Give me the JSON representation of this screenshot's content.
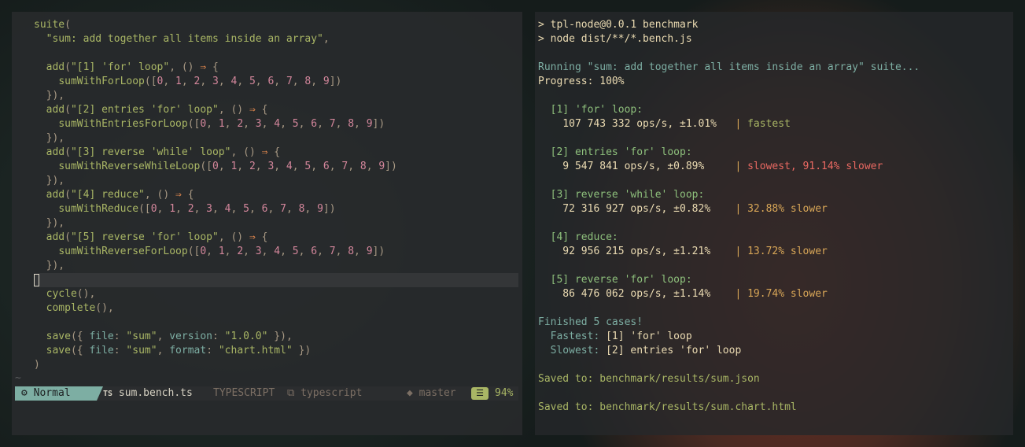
{
  "editor": {
    "lines": [
      [
        {
          "c": "fn",
          "t": "suite"
        },
        {
          "c": "punc",
          "t": "("
        }
      ],
      [
        {
          "c": "plain",
          "t": "  "
        },
        {
          "c": "str",
          "t": "\"sum: add together all items inside an array\""
        },
        {
          "c": "punc",
          "t": ","
        }
      ],
      [],
      [
        {
          "c": "plain",
          "t": "  "
        },
        {
          "c": "fn",
          "t": "add"
        },
        {
          "c": "punc",
          "t": "("
        },
        {
          "c": "str",
          "t": "\"[1] 'for' loop\""
        },
        {
          "c": "punc",
          "t": ", "
        },
        {
          "c": "punc",
          "t": "() "
        },
        {
          "c": "op",
          "t": "⇒"
        },
        {
          "c": "punc",
          "t": " {"
        }
      ],
      [
        {
          "c": "plain",
          "t": "    "
        },
        {
          "c": "fn",
          "t": "sumWithForLoop"
        },
        {
          "c": "punc",
          "t": "(["
        },
        {
          "c": "num",
          "t": "0"
        },
        {
          "c": "punc",
          "t": ", "
        },
        {
          "c": "num",
          "t": "1"
        },
        {
          "c": "punc",
          "t": ", "
        },
        {
          "c": "num",
          "t": "2"
        },
        {
          "c": "punc",
          "t": ", "
        },
        {
          "c": "num",
          "t": "3"
        },
        {
          "c": "punc",
          "t": ", "
        },
        {
          "c": "num",
          "t": "4"
        },
        {
          "c": "punc",
          "t": ", "
        },
        {
          "c": "num",
          "t": "5"
        },
        {
          "c": "punc",
          "t": ", "
        },
        {
          "c": "num",
          "t": "6"
        },
        {
          "c": "punc",
          "t": ", "
        },
        {
          "c": "num",
          "t": "7"
        },
        {
          "c": "punc",
          "t": ", "
        },
        {
          "c": "num",
          "t": "8"
        },
        {
          "c": "punc",
          "t": ", "
        },
        {
          "c": "num",
          "t": "9"
        },
        {
          "c": "punc",
          "t": "])"
        }
      ],
      [
        {
          "c": "plain",
          "t": "  "
        },
        {
          "c": "punc",
          "t": "}),"
        }
      ],
      [
        {
          "c": "plain",
          "t": "  "
        },
        {
          "c": "fn",
          "t": "add"
        },
        {
          "c": "punc",
          "t": "("
        },
        {
          "c": "str",
          "t": "\"[2] entries 'for' loop\""
        },
        {
          "c": "punc",
          "t": ", "
        },
        {
          "c": "punc",
          "t": "() "
        },
        {
          "c": "op",
          "t": "⇒"
        },
        {
          "c": "punc",
          "t": " {"
        }
      ],
      [
        {
          "c": "plain",
          "t": "    "
        },
        {
          "c": "fn",
          "t": "sumWithEntriesForLoop"
        },
        {
          "c": "punc",
          "t": "(["
        },
        {
          "c": "num",
          "t": "0"
        },
        {
          "c": "punc",
          "t": ", "
        },
        {
          "c": "num",
          "t": "1"
        },
        {
          "c": "punc",
          "t": ", "
        },
        {
          "c": "num",
          "t": "2"
        },
        {
          "c": "punc",
          "t": ", "
        },
        {
          "c": "num",
          "t": "3"
        },
        {
          "c": "punc",
          "t": ", "
        },
        {
          "c": "num",
          "t": "4"
        },
        {
          "c": "punc",
          "t": ", "
        },
        {
          "c": "num",
          "t": "5"
        },
        {
          "c": "punc",
          "t": ", "
        },
        {
          "c": "num",
          "t": "6"
        },
        {
          "c": "punc",
          "t": ", "
        },
        {
          "c": "num",
          "t": "7"
        },
        {
          "c": "punc",
          "t": ", "
        },
        {
          "c": "num",
          "t": "8"
        },
        {
          "c": "punc",
          "t": ", "
        },
        {
          "c": "num",
          "t": "9"
        },
        {
          "c": "punc",
          "t": "])"
        }
      ],
      [
        {
          "c": "plain",
          "t": "  "
        },
        {
          "c": "punc",
          "t": "}),"
        }
      ],
      [
        {
          "c": "plain",
          "t": "  "
        },
        {
          "c": "fn",
          "t": "add"
        },
        {
          "c": "punc",
          "t": "("
        },
        {
          "c": "str",
          "t": "\"[3] reverse 'while' loop\""
        },
        {
          "c": "punc",
          "t": ", "
        },
        {
          "c": "punc",
          "t": "() "
        },
        {
          "c": "op",
          "t": "⇒"
        },
        {
          "c": "punc",
          "t": " {"
        }
      ],
      [
        {
          "c": "plain",
          "t": "    "
        },
        {
          "c": "fn",
          "t": "sumWithReverseWhileLoop"
        },
        {
          "c": "punc",
          "t": "(["
        },
        {
          "c": "num",
          "t": "0"
        },
        {
          "c": "punc",
          "t": ", "
        },
        {
          "c": "num",
          "t": "1"
        },
        {
          "c": "punc",
          "t": ", "
        },
        {
          "c": "num",
          "t": "2"
        },
        {
          "c": "punc",
          "t": ", "
        },
        {
          "c": "num",
          "t": "3"
        },
        {
          "c": "punc",
          "t": ", "
        },
        {
          "c": "num",
          "t": "4"
        },
        {
          "c": "punc",
          "t": ", "
        },
        {
          "c": "num",
          "t": "5"
        },
        {
          "c": "punc",
          "t": ", "
        },
        {
          "c": "num",
          "t": "6"
        },
        {
          "c": "punc",
          "t": ", "
        },
        {
          "c": "num",
          "t": "7"
        },
        {
          "c": "punc",
          "t": ", "
        },
        {
          "c": "num",
          "t": "8"
        },
        {
          "c": "punc",
          "t": ", "
        },
        {
          "c": "num",
          "t": "9"
        },
        {
          "c": "punc",
          "t": "])"
        }
      ],
      [
        {
          "c": "plain",
          "t": "  "
        },
        {
          "c": "punc",
          "t": "}),"
        }
      ],
      [
        {
          "c": "plain",
          "t": "  "
        },
        {
          "c": "fn",
          "t": "add"
        },
        {
          "c": "punc",
          "t": "("
        },
        {
          "c": "str",
          "t": "\"[4] reduce\""
        },
        {
          "c": "punc",
          "t": ", "
        },
        {
          "c": "punc",
          "t": "() "
        },
        {
          "c": "op",
          "t": "⇒"
        },
        {
          "c": "punc",
          "t": " {"
        }
      ],
      [
        {
          "c": "plain",
          "t": "    "
        },
        {
          "c": "fn",
          "t": "sumWithReduce"
        },
        {
          "c": "punc",
          "t": "(["
        },
        {
          "c": "num",
          "t": "0"
        },
        {
          "c": "punc",
          "t": ", "
        },
        {
          "c": "num",
          "t": "1"
        },
        {
          "c": "punc",
          "t": ", "
        },
        {
          "c": "num",
          "t": "2"
        },
        {
          "c": "punc",
          "t": ", "
        },
        {
          "c": "num",
          "t": "3"
        },
        {
          "c": "punc",
          "t": ", "
        },
        {
          "c": "num",
          "t": "4"
        },
        {
          "c": "punc",
          "t": ", "
        },
        {
          "c": "num",
          "t": "5"
        },
        {
          "c": "punc",
          "t": ", "
        },
        {
          "c": "num",
          "t": "6"
        },
        {
          "c": "punc",
          "t": ", "
        },
        {
          "c": "num",
          "t": "7"
        },
        {
          "c": "punc",
          "t": ", "
        },
        {
          "c": "num",
          "t": "8"
        },
        {
          "c": "punc",
          "t": ", "
        },
        {
          "c": "num",
          "t": "9"
        },
        {
          "c": "punc",
          "t": "])"
        }
      ],
      [
        {
          "c": "plain",
          "t": "  "
        },
        {
          "c": "punc",
          "t": "}),"
        }
      ],
      [
        {
          "c": "plain",
          "t": "  "
        },
        {
          "c": "fn",
          "t": "add"
        },
        {
          "c": "punc",
          "t": "("
        },
        {
          "c": "str",
          "t": "\"[5] reverse 'for' loop\""
        },
        {
          "c": "punc",
          "t": ", "
        },
        {
          "c": "punc",
          "t": "() "
        },
        {
          "c": "op",
          "t": "⇒"
        },
        {
          "c": "punc",
          "t": " {"
        }
      ],
      [
        {
          "c": "plain",
          "t": "    "
        },
        {
          "c": "fn",
          "t": "sumWithReverseForLoop"
        },
        {
          "c": "punc",
          "t": "(["
        },
        {
          "c": "num",
          "t": "0"
        },
        {
          "c": "punc",
          "t": ", "
        },
        {
          "c": "num",
          "t": "1"
        },
        {
          "c": "punc",
          "t": ", "
        },
        {
          "c": "num",
          "t": "2"
        },
        {
          "c": "punc",
          "t": ", "
        },
        {
          "c": "num",
          "t": "3"
        },
        {
          "c": "punc",
          "t": ", "
        },
        {
          "c": "num",
          "t": "4"
        },
        {
          "c": "punc",
          "t": ", "
        },
        {
          "c": "num",
          "t": "5"
        },
        {
          "c": "punc",
          "t": ", "
        },
        {
          "c": "num",
          "t": "6"
        },
        {
          "c": "punc",
          "t": ", "
        },
        {
          "c": "num",
          "t": "7"
        },
        {
          "c": "punc",
          "t": ", "
        },
        {
          "c": "num",
          "t": "8"
        },
        {
          "c": "punc",
          "t": ", "
        },
        {
          "c": "num",
          "t": "9"
        },
        {
          "c": "punc",
          "t": "])"
        }
      ],
      [
        {
          "c": "plain",
          "t": "  "
        },
        {
          "c": "punc",
          "t": "}),"
        }
      ],
      [],
      [
        {
          "c": "plain",
          "t": "  "
        },
        {
          "c": "fn",
          "t": "cycle"
        },
        {
          "c": "punc",
          "t": "(),"
        }
      ],
      [
        {
          "c": "plain",
          "t": "  "
        },
        {
          "c": "fn",
          "t": "complete"
        },
        {
          "c": "punc",
          "t": "(),"
        }
      ],
      [],
      [
        {
          "c": "plain",
          "t": "  "
        },
        {
          "c": "fn",
          "t": "save"
        },
        {
          "c": "punc",
          "t": "({ "
        },
        {
          "c": "prop",
          "t": "file"
        },
        {
          "c": "punc",
          "t": ": "
        },
        {
          "c": "str",
          "t": "\"sum\""
        },
        {
          "c": "punc",
          "t": ", "
        },
        {
          "c": "prop",
          "t": "version"
        },
        {
          "c": "punc",
          "t": ": "
        },
        {
          "c": "str",
          "t": "\"1.0.0\""
        },
        {
          "c": "punc",
          "t": " }),"
        }
      ],
      [
        {
          "c": "plain",
          "t": "  "
        },
        {
          "c": "fn",
          "t": "save"
        },
        {
          "c": "punc",
          "t": "({ "
        },
        {
          "c": "prop",
          "t": "file"
        },
        {
          "c": "punc",
          "t": ": "
        },
        {
          "c": "str",
          "t": "\"sum\""
        },
        {
          "c": "punc",
          "t": ", "
        },
        {
          "c": "prop",
          "t": "format"
        },
        {
          "c": "punc",
          "t": ": "
        },
        {
          "c": "str",
          "t": "\"chart.html\""
        },
        {
          "c": "punc",
          "t": " })"
        }
      ],
      [
        {
          "c": "punc",
          "t": ")"
        }
      ]
    ],
    "tilde": "~"
  },
  "statusline": {
    "mode": "Normal",
    "mode_icon": "⚙",
    "file_icon": "TS",
    "file": "sum.bench.ts",
    "filetype": "TYPESCRIPT",
    "lsp_icon": "⧉",
    "lsp": "typescript",
    "branch_icon": "◆",
    "branch": "master",
    "percent_icon": "☰",
    "percent": "94%"
  },
  "terminal": {
    "lines": [
      [
        {
          "c": "t-cmd",
          "t": "> tpl-node@0.0.1 benchmark"
        }
      ],
      [
        {
          "c": "t-cmd",
          "t": "> node dist/**/*.bench.js"
        }
      ],
      [],
      [
        {
          "c": "t-info",
          "t": "Running \"sum: add together all items inside an array\" suite..."
        }
      ],
      [
        {
          "c": "t-white",
          "t": "Progress: 100%"
        }
      ],
      [],
      [
        {
          "c": "t-case",
          "t": "  [1] 'for' loop:"
        }
      ],
      [
        {
          "c": "t-white",
          "t": "    107 743 332 ops/s, ±1.01%   "
        },
        {
          "c": "t-sep",
          "t": "| "
        },
        {
          "c": "t-green",
          "t": "fastest"
        }
      ],
      [],
      [
        {
          "c": "t-case",
          "t": "  [2] entries 'for' loop:"
        }
      ],
      [
        {
          "c": "t-white",
          "t": "    9 547 841 ops/s, ±0.89%     "
        },
        {
          "c": "t-sep",
          "t": "| "
        },
        {
          "c": "t-red",
          "t": "slowest, 91.14% slower"
        }
      ],
      [],
      [
        {
          "c": "t-case",
          "t": "  [3] reverse 'while' loop:"
        }
      ],
      [
        {
          "c": "t-white",
          "t": "    72 316 927 ops/s, ±0.82%    "
        },
        {
          "c": "t-sep",
          "t": "| "
        },
        {
          "c": "t-yellow",
          "t": "32.88% slower"
        }
      ],
      [],
      [
        {
          "c": "t-case",
          "t": "  [4] reduce:"
        }
      ],
      [
        {
          "c": "t-white",
          "t": "    92 956 215 ops/s, ±1.21%    "
        },
        {
          "c": "t-sep",
          "t": "| "
        },
        {
          "c": "t-yellow",
          "t": "13.72% slower"
        }
      ],
      [],
      [
        {
          "c": "t-case",
          "t": "  [5] reverse 'for' loop:"
        }
      ],
      [
        {
          "c": "t-white",
          "t": "    86 476 062 ops/s, ±1.14%    "
        },
        {
          "c": "t-sep",
          "t": "| "
        },
        {
          "c": "t-yellow",
          "t": "19.74% slower"
        }
      ],
      [],
      [
        {
          "c": "t-info",
          "t": "Finished 5 cases!"
        }
      ],
      [
        {
          "c": "t-info",
          "t": "  Fastest: "
        },
        {
          "c": "t-white",
          "t": "[1] 'for' loop"
        }
      ],
      [
        {
          "c": "t-info",
          "t": "  Slowest: "
        },
        {
          "c": "t-white",
          "t": "[2] entries 'for' loop"
        }
      ],
      [],
      [
        {
          "c": "t-green",
          "t": "Saved to: benchmark/results/sum.json"
        }
      ],
      [],
      [
        {
          "c": "t-green",
          "t": "Saved to: benchmark/results/sum.chart.html"
        }
      ]
    ]
  }
}
